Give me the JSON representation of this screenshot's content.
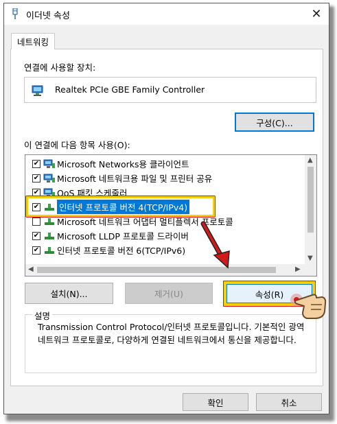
{
  "window": {
    "title": "이더넷 속성",
    "tab": "네트워킹"
  },
  "connect_label": "연결에 사용할 장치:",
  "device": {
    "name": "Realtek PCIe GBE Family Controller"
  },
  "configure_button": "구성(C)...",
  "items_label": "이 연결에 다음 항목 사용(O):",
  "items": [
    {
      "label": "Microsoft Networks용 클라이언트",
      "checked": true,
      "icon": "network-client-icon"
    },
    {
      "label": "Microsoft 네트워크용 파일 및 프린터 공유",
      "checked": true,
      "icon": "network-client-icon"
    },
    {
      "label": "QoS 패킷 스케줄러",
      "checked": true,
      "icon": "network-client-icon"
    },
    {
      "label": "인터넷 프로토콜 버전 4(TCP/IPv4)",
      "checked": true,
      "icon": "protocol-icon",
      "selected": true
    },
    {
      "label": "Microsoft 네트워크 어댑터 멀티플렉서 프로토콜",
      "checked": false,
      "icon": "protocol-icon"
    },
    {
      "label": "Microsoft LLDP 프로토콜 드라이버",
      "checked": true,
      "icon": "protocol-icon"
    },
    {
      "label": "인터넷 프로토콜 버전 6(TCP/IPv6)",
      "checked": true,
      "icon": "protocol-icon"
    }
  ],
  "buttons": {
    "install": "설치(N)...",
    "uninstall": "제거(U)",
    "properties": "속성(R)",
    "ok": "확인",
    "cancel": "취소"
  },
  "description": {
    "title": "설명",
    "text": "Transmission Control Protocol/인터넷 프로토콜입니다. 기본적인 광역 네트워크 프로토콜로, 다양하게 연결된 네트워크에서 통신을 제공합니다."
  },
  "colors": {
    "selection": "#0078d7",
    "highlight_border": "#f5d00a",
    "annotation_arrow": "#d11a1a"
  }
}
